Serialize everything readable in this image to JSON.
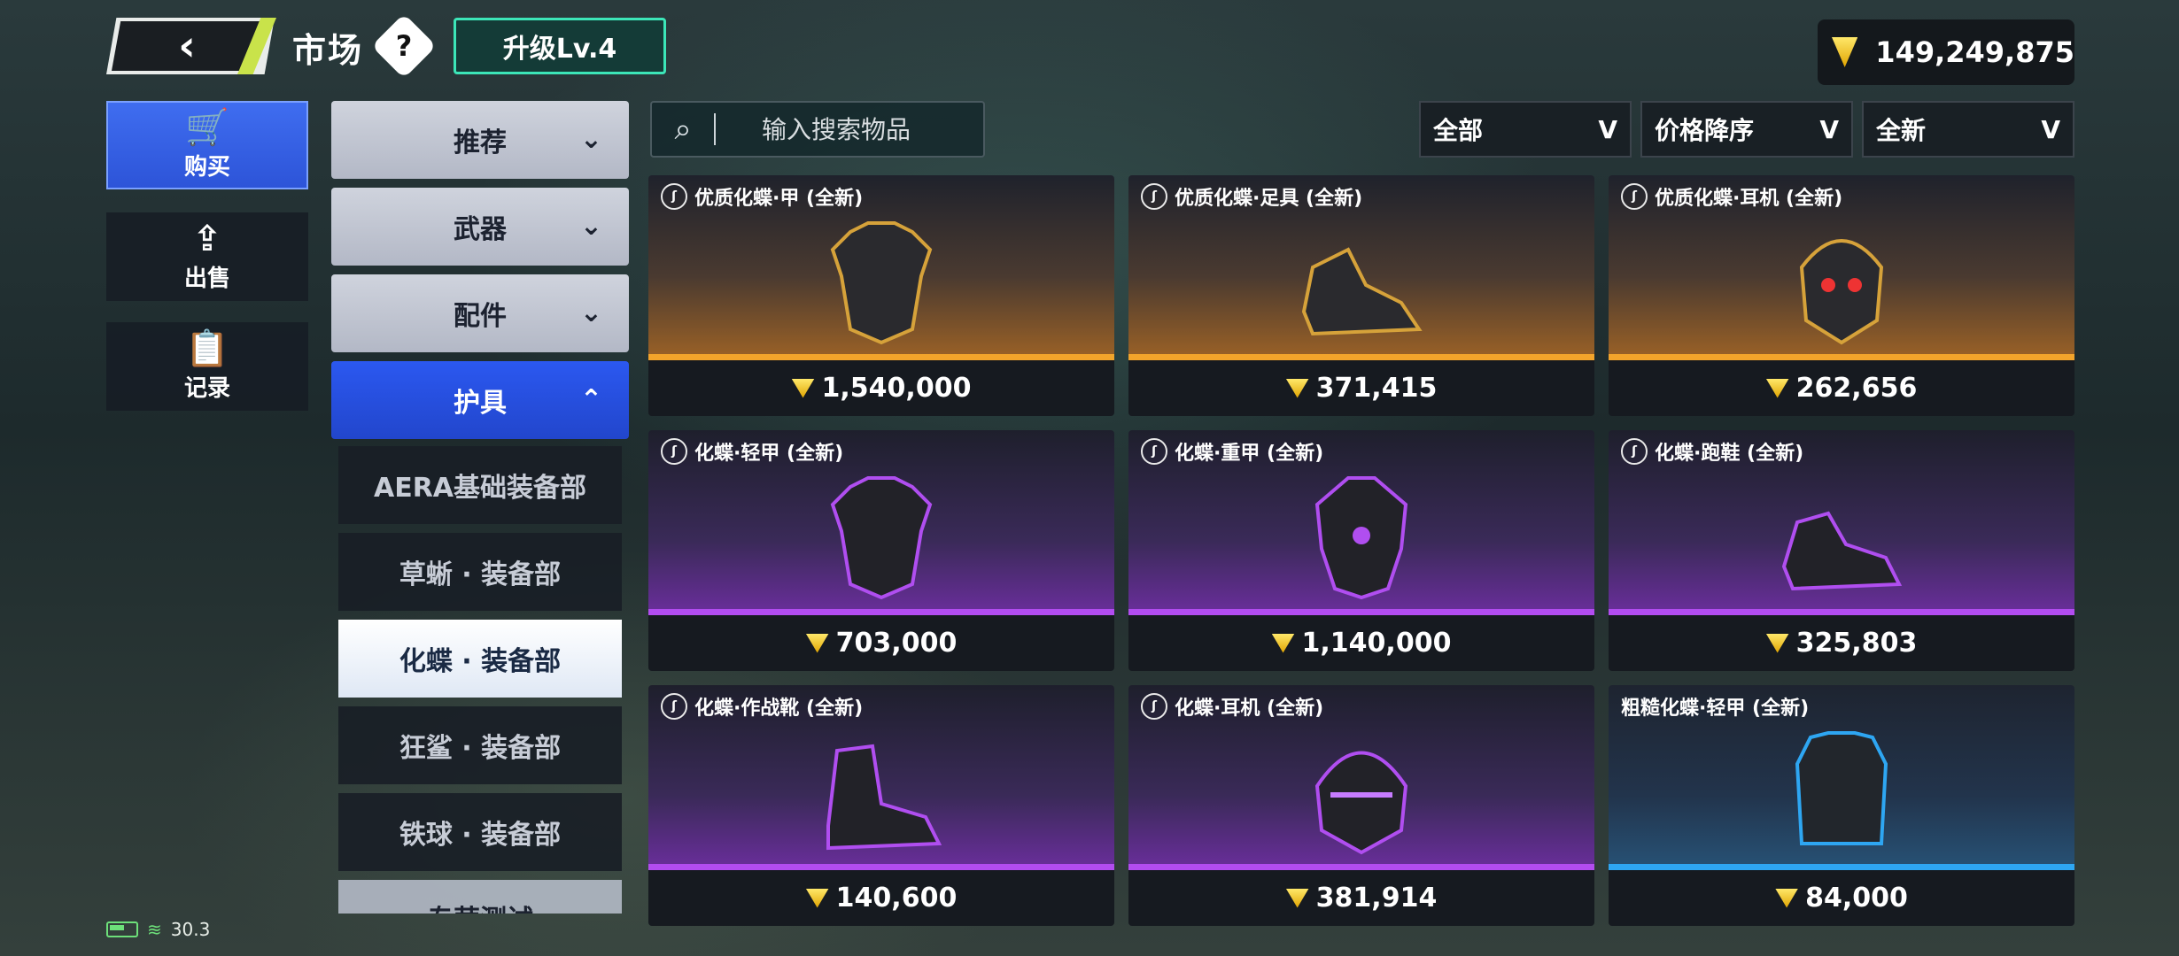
{
  "header": {
    "title": "市场",
    "help": "?",
    "level": "升级Lv.4",
    "currency": "149,249,875"
  },
  "nav": [
    {
      "label": "购买",
      "icon": "cart-icon"
    },
    {
      "label": "出售",
      "icon": "upload-icon"
    },
    {
      "label": "记录",
      "icon": "clipboard-icon"
    }
  ],
  "categories": {
    "c1": "推荐",
    "c2": "武器",
    "c3": "配件",
    "c4": "护具"
  },
  "subcategories": {
    "s1": "AERA基础装备部",
    "s2": "草蜥 · 装备部",
    "s3": "化蝶 · 装备部",
    "s4": "狂鲨 · 装备部",
    "s5": "铁球 · 装备部",
    "s6": "专营测试"
  },
  "search": {
    "placeholder": "输入搜索物品"
  },
  "filters": {
    "f1": "全部",
    "f2": "价格降序",
    "f3": "全新"
  },
  "items": [
    {
      "name": "优质化蝶·甲 (全新)",
      "price": "1,540,000",
      "tier": "gold"
    },
    {
      "name": "优质化蝶·足具 (全新)",
      "price": "371,415",
      "tier": "gold"
    },
    {
      "name": "优质化蝶·耳机 (全新)",
      "price": "262,656",
      "tier": "gold"
    },
    {
      "name": "化蝶·轻甲 (全新)",
      "price": "703,000",
      "tier": "purple"
    },
    {
      "name": "化蝶·重甲 (全新)",
      "price": "1,140,000",
      "tier": "purple"
    },
    {
      "name": "化蝶·跑鞋 (全新)",
      "price": "325,803",
      "tier": "purple"
    },
    {
      "name": "化蝶·作战靴 (全新)",
      "price": "140,600",
      "tier": "purple"
    },
    {
      "name": "化蝶·耳机 (全新)",
      "price": "381,914",
      "tier": "purple"
    },
    {
      "name": "粗糙化蝶·轻甲 (全新)",
      "price": "84,000",
      "tier": "blue"
    }
  ],
  "status": {
    "fps": "30.3"
  }
}
